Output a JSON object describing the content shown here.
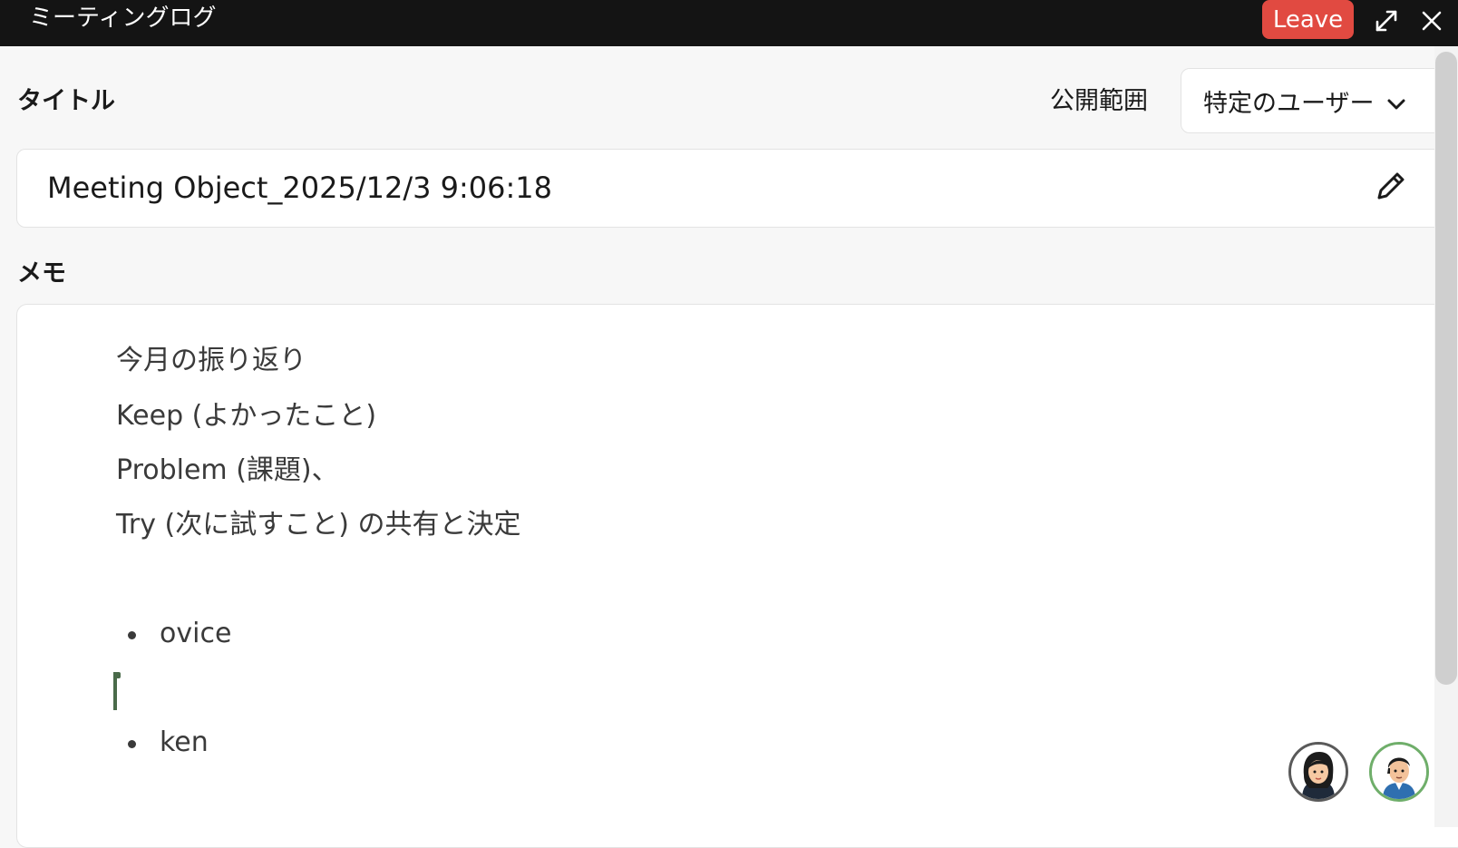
{
  "window": {
    "title": "ミーティングログ",
    "leave_label": "Leave",
    "accent_leave": "#e14a41"
  },
  "form": {
    "title_label": "タイトル",
    "visibility_label": "公開範囲",
    "visibility_value": "特定のユーザー",
    "title_value": "Meeting Object_2025/12/3 9:06:18",
    "memo_label": "メモ"
  },
  "memo": {
    "lines": [
      "今月の振り返り",
      "Keep (よかったこと)",
      "Problem (課題)、",
      "Try (次に試すこと) の共有と決定"
    ],
    "bullets": [
      "ovice",
      "ken"
    ]
  },
  "icons": {
    "expand": "expand-icon",
    "close": "close-icon",
    "edit": "pencil-icon",
    "chevron": "chevron-down-icon"
  }
}
